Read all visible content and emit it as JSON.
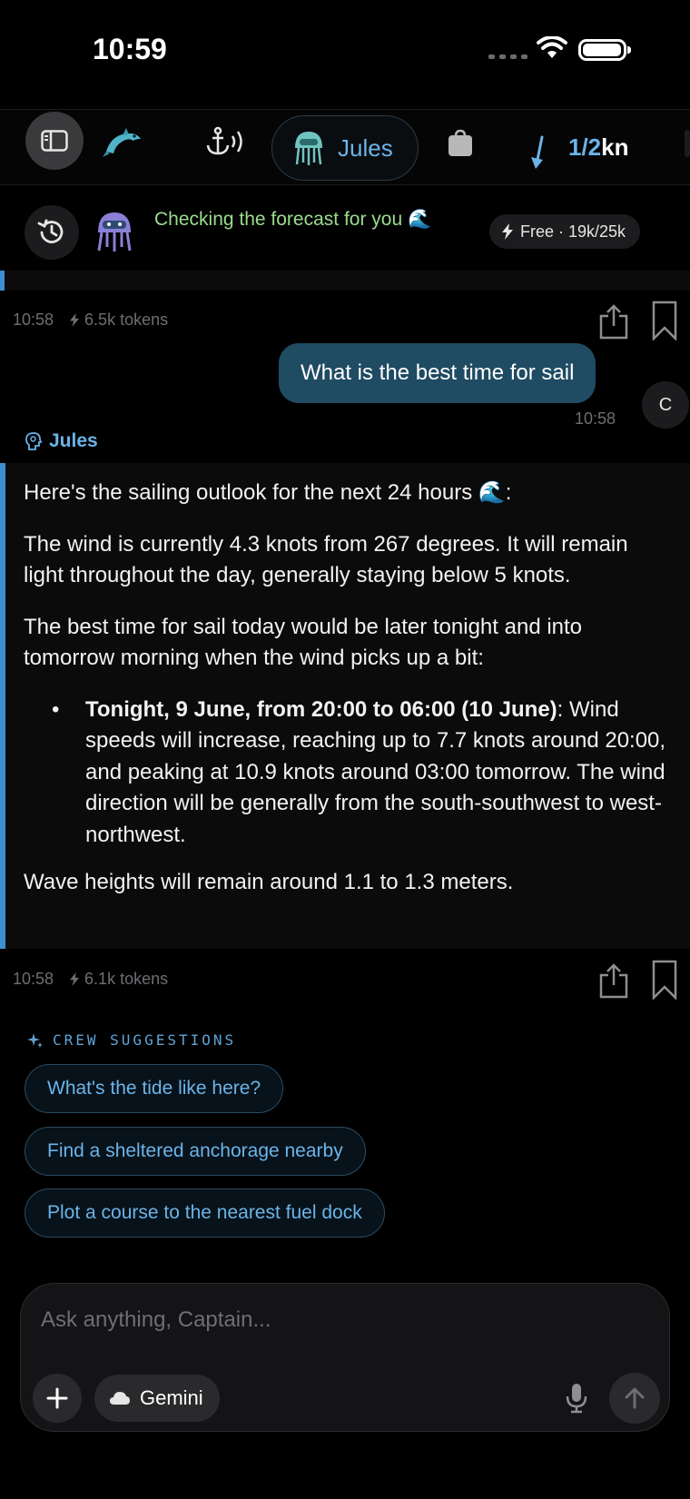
{
  "status_bar": {
    "time": "10:59"
  },
  "crew_bar": {
    "active_agent": "Jules",
    "wind": {
      "speed": "1/2",
      "unit": "kn",
      "direction_deg": 200
    }
  },
  "agent_status": {
    "text": "Checking the forecast for you 🌊",
    "plan": "Free · 19k/25k"
  },
  "first_meta": {
    "time": "10:58",
    "tokens": "6.5k tokens"
  },
  "user_message": {
    "text": "What is the best time for sail",
    "time": "10:58",
    "avatar": "C"
  },
  "assistant": {
    "name": "Jules",
    "intro": "Here's the sailing outlook for the next 24 hours 🌊:",
    "p1": "The wind is currently 4.3 knots from 267 degrees. It will remain light throughout the day, generally staying below 5 knots.",
    "p2": "The best time for sail today would be later tonight and into tomorrow morning when the wind picks up a bit:",
    "bullet_bold": "Tonight, 9 June, from 20:00 to 06:00 (10 June)",
    "bullet_text": ": Wind speeds will increase, reaching up to 7.7 knots around 20:00, and peaking at 10.9 knots around 03:00 tomorrow. The wind direction will be generally from the south-southwest to west-northwest.",
    "p3": "Wave heights will remain around 1.1 to 1.3 meters.",
    "time": "10:58",
    "tokens": "6.1k tokens"
  },
  "suggestions": {
    "heading": "CREW SUGGESTIONS",
    "items": [
      "What's the tide like here?",
      "Find a sheltered anchorage nearby",
      "Plot a course to the nearest fuel dock"
    ]
  },
  "composer": {
    "placeholder": "Ask anything, Captain...",
    "model": "Gemini"
  },
  "colors": {
    "accent": "#6bb4e8",
    "user_bubble": "#1f4b63",
    "status_green": "#9bdb8f",
    "background": "#000000"
  }
}
